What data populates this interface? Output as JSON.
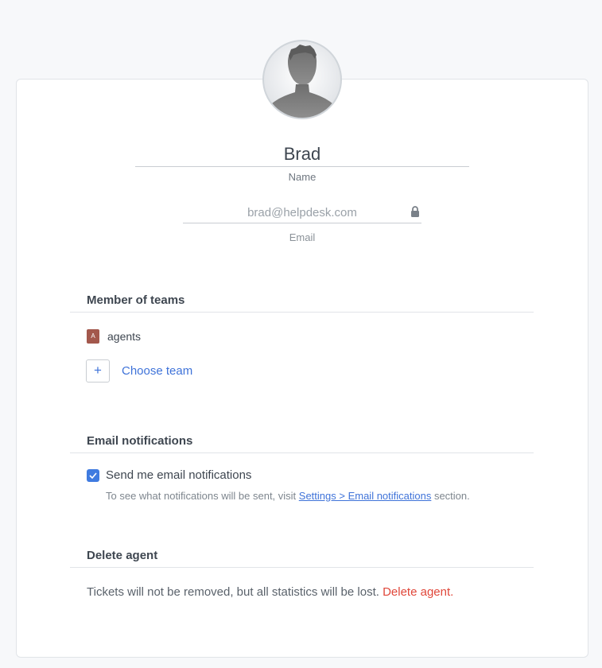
{
  "profile": {
    "avatar_icon": "user-silhouette-icon",
    "name": "Brad",
    "name_label": "Name",
    "email": "brad@helpdesk.com",
    "email_label": "Email",
    "email_lock_icon": "lock-icon"
  },
  "teams": {
    "title": "Member of teams",
    "items": [
      {
        "initial": "A",
        "name": "agents",
        "color": "#a3584c"
      }
    ],
    "add_icon": "+",
    "choose_label": "Choose team"
  },
  "notifications": {
    "title": "Email notifications",
    "checkbox_label": "Send me email notifications",
    "checked": true,
    "help_prefix": "To see what notifications will be sent, visit ",
    "help_link": "Settings > Email notifications",
    "help_suffix": " section."
  },
  "delete": {
    "title": "Delete agent",
    "text": "Tickets will not be removed, but all statistics will be lost. ",
    "link": "Delete agent."
  },
  "colors": {
    "accent": "#3f73d9",
    "danger": "#e0473a",
    "team_badge": "#a3584c"
  }
}
